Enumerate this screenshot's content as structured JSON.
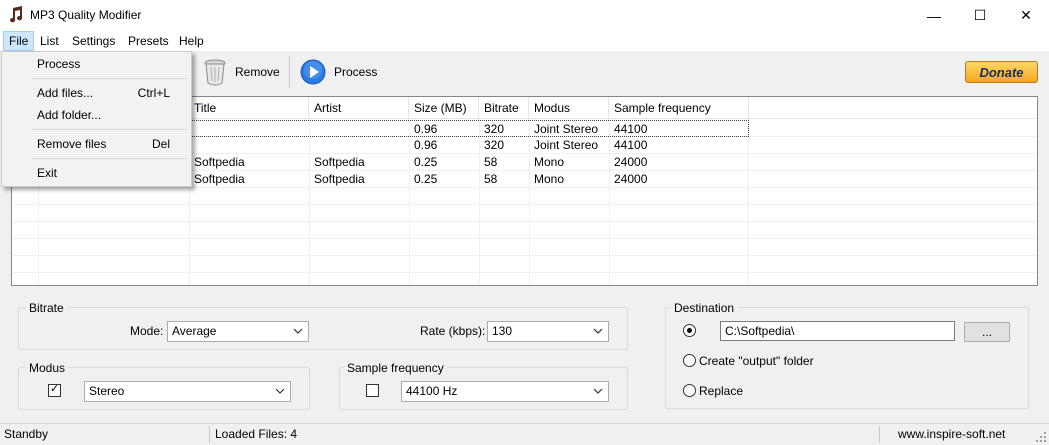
{
  "window": {
    "title": "MP3 Quality Modifier",
    "minimize_glyph": "—",
    "maximize_glyph": "☐",
    "close_glyph": "✕"
  },
  "menu": {
    "items": [
      "File",
      "List",
      "Settings",
      "Presets",
      "Help"
    ]
  },
  "file_menu": {
    "process": "Process",
    "add_files": "Add files...",
    "add_files_shortcut": "Ctrl+L",
    "add_folder": "Add folder...",
    "remove_files": "Remove files",
    "remove_files_shortcut": "Del",
    "exit": "Exit"
  },
  "toolbar": {
    "remove_label": "Remove",
    "process_label": "Process",
    "donate_label": "Donate"
  },
  "table": {
    "columns": [
      "Title",
      "Artist",
      "Size  (MB)",
      "Bitrate",
      "Modus",
      "Sample frequency"
    ],
    "rows": [
      [
        "",
        "",
        "0.96",
        "320",
        "Joint Stereo",
        "44100"
      ],
      [
        "",
        "",
        "0.96",
        "320",
        "Joint Stereo",
        "44100"
      ],
      [
        "Softpedia",
        "Softpedia",
        "0.25",
        "58",
        "Mono",
        "24000"
      ],
      [
        "Softpedia",
        "Softpedia",
        "0.25",
        "58",
        "Mono",
        "24000"
      ]
    ]
  },
  "bitrate": {
    "group_label": "Bitrate",
    "mode_label": "Mode:",
    "mode_value": "Average",
    "rate_label": "Rate (kbps):",
    "rate_value": "130"
  },
  "modus": {
    "group_label": "Modus",
    "checkbox_glyph": "✓",
    "value": "Stereo"
  },
  "sample_frequency": {
    "group_label": "Sample frequency",
    "value": "44100 Hz"
  },
  "destination": {
    "group_label": "Destination",
    "path": "C:\\Softpedia\\",
    "browse_label": "...",
    "create_output_label": "Create \"output\" folder",
    "replace_label": "Replace"
  },
  "status": {
    "state": "Standby",
    "loaded_files": "Loaded Files: 4",
    "website": "www.inspire-soft.net"
  },
  "colors": {
    "menu_highlight": "#cce8ff",
    "donate_gold": "#f5a623",
    "process_blue": "#2a7be4"
  }
}
